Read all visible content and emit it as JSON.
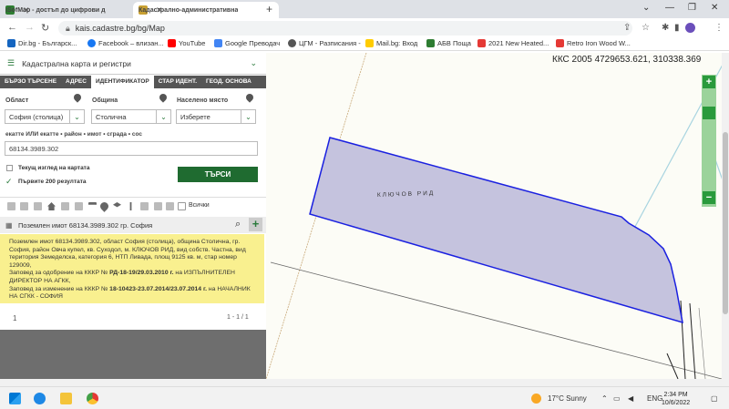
{
  "browser": {
    "tabs": [
      {
        "label": "iSofMap - достъп до цифрови д",
        "active": false
      },
      {
        "label": "Кадастрално-административна",
        "active": true
      }
    ],
    "url": "kais.cadastre.bg/bg/Map",
    "bookmarks": [
      "Dir.bg - Българск...",
      "Facebook – влизан...",
      "YouTube",
      "Google Преводач",
      "ЦГМ - Разписания -",
      "Mail.bg: Вход",
      "АБВ Поща",
      "2021 New Heated...",
      "Retro Iron Wood W..."
    ]
  },
  "panel": {
    "header": "Кадастрална карта и регистри",
    "tabs": [
      "БЪРЗО ТЪРСЕНЕ",
      "АДРЕС",
      "ИДЕНТИФИКАТОР",
      "СТАР ИДЕНТ.",
      "ГЕОД. ОСНОВА"
    ],
    "labels": {
      "oblast": "Област",
      "obshtina": "Община",
      "naseleno": "Населено място",
      "ekatte": "екатте ИЛИ екатте • район • имот • сграда • сос"
    },
    "values": {
      "oblast": "София (столица)",
      "obshtina": "Столична",
      "naseleno": "Изберете",
      "identifier": "68134.3989.302"
    },
    "checkbox1": "Текущ изглед на картата",
    "checkbox2": "Първите 200 резултата",
    "search_button": "ТЪРСИ",
    "all_label": "Всички",
    "result_title": "Поземлен имот 68134.3989.302 гр. София",
    "result_text_1": "Поземлен имот 68134.3989.302, област София (столица), община Столична, гр. София, район Овча купел, кв. Суходол, м. КЛЮЧОВ РИД, вид собств. Частна, вид територия Земеделска, категория 6, НТП Ливада, площ 9125 кв. м, стар номер 129009,",
    "result_text_2a": "Заповед за одобрение на КККР № ",
    "result_text_2b": "РД-18-19/29.03.2010 г.",
    "result_text_2c": " на ИЗПЪЛНИТЕЛЕН ДИРЕКТОР НА АГКК,",
    "result_text_3a": "Заповед за изменение на КККР № ",
    "result_text_3b": "18-10423-23.07.2014/23.07.2014 г.",
    "result_text_3c": " на НАЧАЛНИК НА СГКК - СОФИЯ",
    "page_number": "1",
    "page_range": "1 - 1 / 1"
  },
  "map": {
    "coords": "ККС 2005 4729653.621, 310338.369",
    "place_label": "КЛЮЧОВ РИД"
  },
  "taskbar": {
    "weather": "17°C  Sunny",
    "lang": "ENG",
    "time": "2:34 PM",
    "date": "10/6/2022"
  }
}
